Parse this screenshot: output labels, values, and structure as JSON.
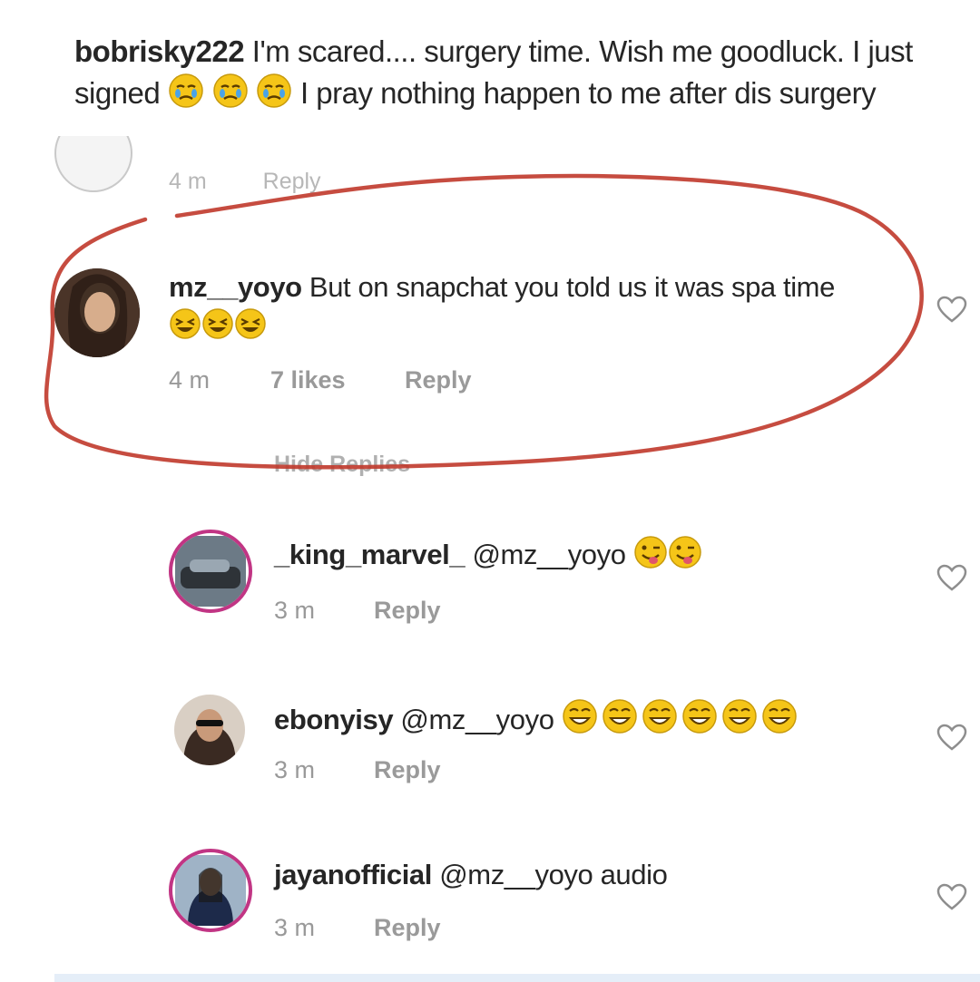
{
  "caption": {
    "username": "bobrisky222",
    "text_before": "I'm scared.... surgery time. Wish me goodluck. I just signed",
    "text_after": "I pray nothing happen to me after dis surgery"
  },
  "previous_meta": {
    "time": "4 m",
    "reply": "Reply"
  },
  "main_comment": {
    "username": "mz__yoyo",
    "text": "But on snapchat you told us it was spa time",
    "time": "4 m",
    "likes": "7 likes",
    "reply": "Reply"
  },
  "hide_replies": "Hide Replies",
  "replies": [
    {
      "username": "_king_marvel_",
      "mention": "@mz__yoyo",
      "text": "",
      "time": "3 m",
      "reply": "Reply"
    },
    {
      "username": "ebonyisy",
      "mention": "@mz__yoyo",
      "text": "",
      "time": "3 m",
      "reply": "Reply"
    },
    {
      "username": "jayanofficial",
      "mention": "@mz__yoyo",
      "text": "audio",
      "time": "3 m",
      "reply": "Reply"
    }
  ],
  "icons": [
    "crying-face-emoji",
    "grinning-squint-emoji",
    "winking-tongue-emoji",
    "heart-outline-icon"
  ],
  "colors": {
    "highlight_circle": "#c0392b",
    "story_ring": "#c13584",
    "emoji": "#f5c518"
  }
}
